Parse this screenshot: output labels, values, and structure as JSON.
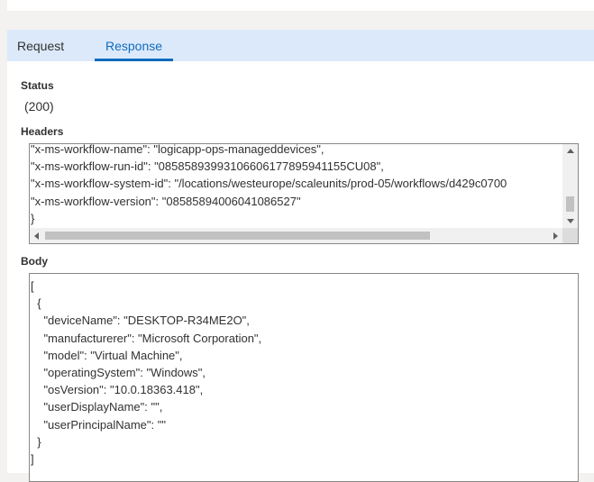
{
  "tabs": {
    "request_label": "Request",
    "response_label": "Response",
    "active": "Response"
  },
  "status": {
    "label": "Status",
    "value": "(200)"
  },
  "headers": {
    "label": "Headers",
    "code": "\"x-ms-workflow-name\": \"logicapp-ops-manageddevices\",\n\"x-ms-workflow-run-id\": \"08585893993106606177895941155CU08\",\n\"x-ms-workflow-system-id\": \"/locations/westeurope/scaleunits/prod-05/workflows/d429c0700\n\"x-ms-workflow-version\": \"08585894006041086527\"\n}"
  },
  "body": {
    "label": "Body",
    "code": "[\n  {\n    \"deviceName\": \"DESKTOP-R34ME2O\",\n    \"manufacturerer\": \"Microsoft Corporation\",\n    \"model\": \"Virtual Machine\",\n    \"operatingSystem\": \"Windows\",\n    \"osVersion\": \"10.0.18363.418\",\n    \"userDisplayName\": \"\",\n    \"userPrincipalName\": \"\"\n  }\n]"
  },
  "colors": {
    "accent": "#0f6cbd",
    "tab_bar_bg": "#dce9fb",
    "page_bg": "#f3f2f1"
  },
  "icons": [
    "chevron-up-icon",
    "chevron-down-icon",
    "chevron-left-icon",
    "chevron-right-icon"
  ]
}
